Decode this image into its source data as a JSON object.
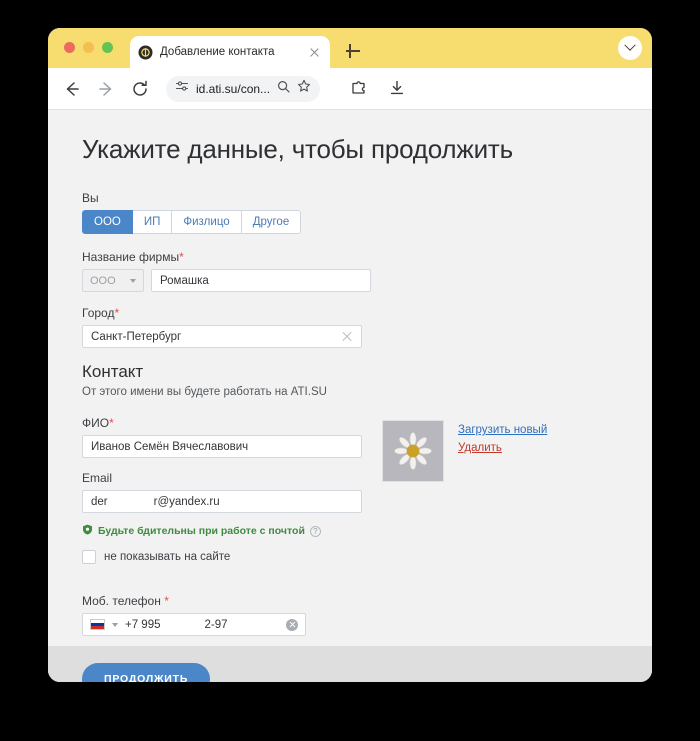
{
  "browser": {
    "tab": {
      "title": "Добавление контакта",
      "favicon_name": "ati-logo-icon",
      "close_label": "×"
    },
    "new_tab_label": "+",
    "toolbar": {
      "back_label": "←",
      "forward_label": "→",
      "reload_label": "⟳",
      "url": "id.ati.su/con...",
      "site_settings_icon": "tune-icon",
      "search_icon": "search-icon",
      "bookmark_icon": "star-icon",
      "extensions_icon": "puzzle-icon",
      "downloads_icon": "download-icon",
      "tab_list_icon": "chevron-down-icon"
    }
  },
  "page": {
    "title": "Укажите данные, чтобы продолжить",
    "entity": {
      "label": "Вы",
      "options": [
        "ООО",
        "ИП",
        "Физлицо",
        "Другое"
      ],
      "selected": "ООО"
    },
    "firm": {
      "label": "Название фирмы",
      "required": "*",
      "type_value": "ООО",
      "name_value": "Ромашка"
    },
    "city": {
      "label": "Город",
      "required": "*",
      "value": "Санкт-Петербург"
    },
    "contact": {
      "title": "Контакт",
      "subtitle": "От этого имени вы будете работать на ATI.SU",
      "fio": {
        "label": "ФИО",
        "required": "*",
        "value": "Иванов Семён Вячеславович"
      },
      "email": {
        "label": "Email",
        "value_prefix": "der",
        "value_suffix": "r@yandex.ru"
      },
      "warning": {
        "text": "Будьте бдительны при работе с почтой",
        "help": "?"
      },
      "hide_checkbox": {
        "label": "не показывать на сайте",
        "checked": false
      },
      "avatar": {
        "upload_label": "Загрузить новый",
        "delete_label": "Удалить"
      }
    },
    "phone": {
      "label": "Моб. телефон",
      "required": "*",
      "country": "RU",
      "prefix": "+7 995",
      "suffix": "2-97"
    },
    "submit_label": "ПРОДОЛЖИТЬ"
  },
  "colors": {
    "accent": "#4a86c8",
    "tabbar": "#f7dc6f",
    "link": "#2f6fbf",
    "danger": "#c0392b",
    "success": "#3f8b3f"
  }
}
